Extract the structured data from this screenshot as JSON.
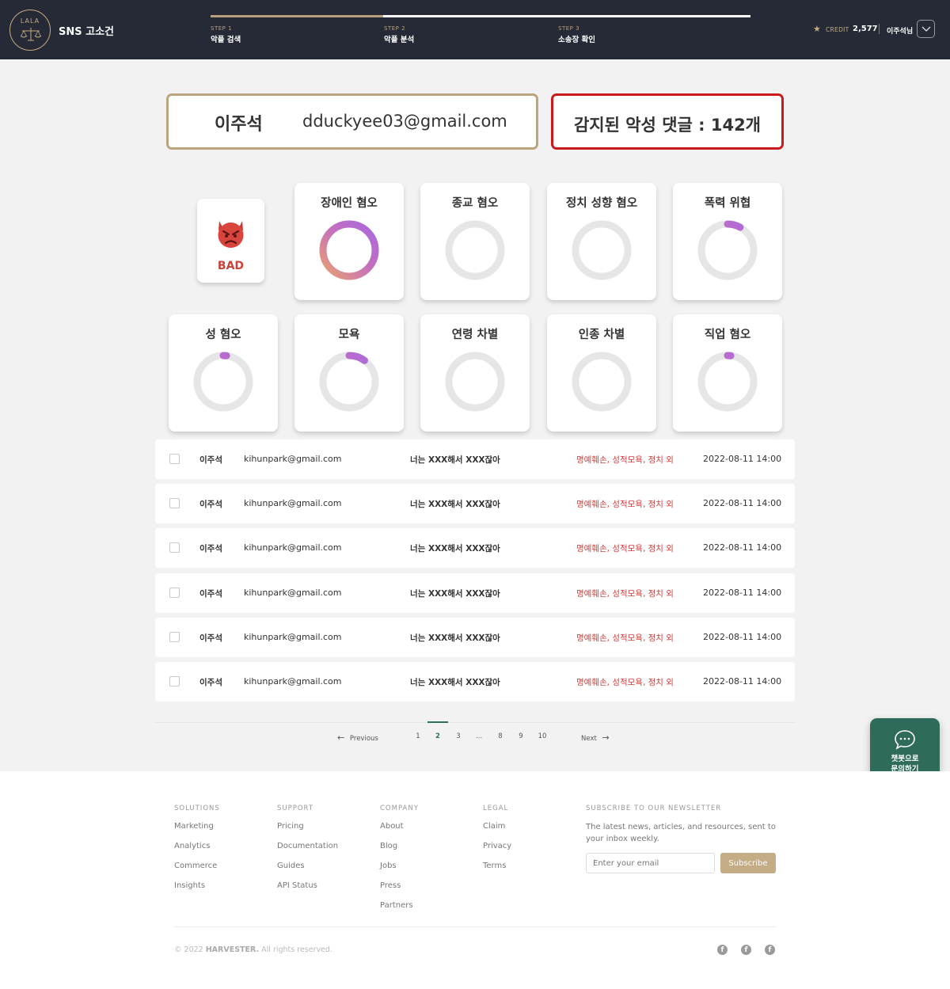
{
  "header": {
    "logo_text": "LALA",
    "brand": "SNS 고소건",
    "progress_fraction": 0.32,
    "steps": [
      {
        "num": "STEP 1",
        "label": "악플 검색"
      },
      {
        "num": "STEP 2",
        "label": "악플 분석"
      },
      {
        "num": "STEP 3",
        "label": "소송장 확인"
      }
    ],
    "credit_icon": "star-icon",
    "credit_label": "CREDIT",
    "credit_value": "2,577",
    "user_name": "이주석님"
  },
  "summary": {
    "name": "이주석",
    "email": "dduckyee03@gmail.com",
    "detected": "감지된 악성 댓글 : 142개"
  },
  "verdict": {
    "icon": "angry-devil-icon",
    "label": "BAD"
  },
  "categories": [
    {
      "name": "장애인 혐오",
      "fraction": 1.0
    },
    {
      "name": "종교 혐오",
      "fraction": 0
    },
    {
      "name": "정치 성향 혐오",
      "fraction": 0
    },
    {
      "name": "폭력 위협",
      "fraction": 0.08
    },
    {
      "name": "성 혐오",
      "fraction": 0.02
    },
    {
      "name": "모욕",
      "fraction": 0.1
    },
    {
      "name": "연령 차별",
      "fraction": 0
    },
    {
      "name": "인종 차별",
      "fraction": 0
    },
    {
      "name": "직업 혐오",
      "fraction": 0.02
    }
  ],
  "colors": {
    "accent_gold": "#bba57d",
    "danger": "#c91b1b",
    "chatbot": "#2f6b5b",
    "donut_track": "#e6e6e6",
    "donut_start": "#e8a070",
    "donut_end": "#a868e0"
  },
  "rows": [
    {
      "name": "이주석",
      "email": "kihunpark@gmail.com",
      "comment": "너는 XXX해서 XXX잖아",
      "categories": "명예훼손, 성적모욕, 정치 외",
      "date": "2022-08-11 14:00"
    },
    {
      "name": "이주석",
      "email": "kihunpark@gmail.com",
      "comment": "너는 XXX해서 XXX잖아",
      "categories": "명예훼손, 성적모욕, 정치 외",
      "date": "2022-08-11 14:00"
    },
    {
      "name": "이주석",
      "email": "kihunpark@gmail.com",
      "comment": "너는 XXX해서 XXX잖아",
      "categories": "명예훼손, 성적모욕, 정치 외",
      "date": "2022-08-11 14:00"
    },
    {
      "name": "이주석",
      "email": "kihunpark@gmail.com",
      "comment": "너는 XXX해서 XXX잖아",
      "categories": "명예훼손, 성적모욕, 정치 외",
      "date": "2022-08-11 14:00"
    },
    {
      "name": "이주석",
      "email": "kihunpark@gmail.com",
      "comment": "너는 XXX해서 XXX잖아",
      "categories": "명예훼손, 성적모욕, 정치 외",
      "date": "2022-08-11 14:00"
    },
    {
      "name": "이주석",
      "email": "kihunpark@gmail.com",
      "comment": "너는 XXX해서 XXX잖아",
      "categories": "명예훼손, 성적모욕, 정치 외",
      "date": "2022-08-11 14:00"
    }
  ],
  "pagination": {
    "previous": "Previous",
    "next": "Next",
    "pages": [
      "1",
      "2",
      "3",
      "...",
      "8",
      "9",
      "10"
    ],
    "current": "2"
  },
  "chatbot": {
    "icon": "chat-bubble-icon",
    "line1": "챗봇으로",
    "line2": "문의하기"
  },
  "footer": {
    "columns": [
      {
        "heading": "SOLUTIONS",
        "links": [
          "Marketing",
          "Analytics",
          "Commerce",
          "Insights"
        ]
      },
      {
        "heading": "SUPPORT",
        "links": [
          "Pricing",
          "Documentation",
          "Guides",
          "API Status"
        ]
      },
      {
        "heading": "COMPANY",
        "links": [
          "About",
          "Blog",
          "Jobs",
          "Press",
          "Partners"
        ]
      },
      {
        "heading": "LEGAL",
        "links": [
          "Claim",
          "Privacy",
          "Terms"
        ]
      }
    ],
    "newsletter_heading": "SUBSCRIBE TO OUR NEWSLETTER",
    "newsletter_desc": "The latest news, articles, and resources, sent to your inbox weekly.",
    "email_placeholder": "Enter your email",
    "subscribe": "Subscribe",
    "copyright_prefix": "© 2022",
    "copyright_brand": "HARVESTER.",
    "copyright_suffix": "All rights reserved.",
    "social_icons": [
      "facebook-icon",
      "facebook-icon",
      "facebook-icon"
    ]
  }
}
